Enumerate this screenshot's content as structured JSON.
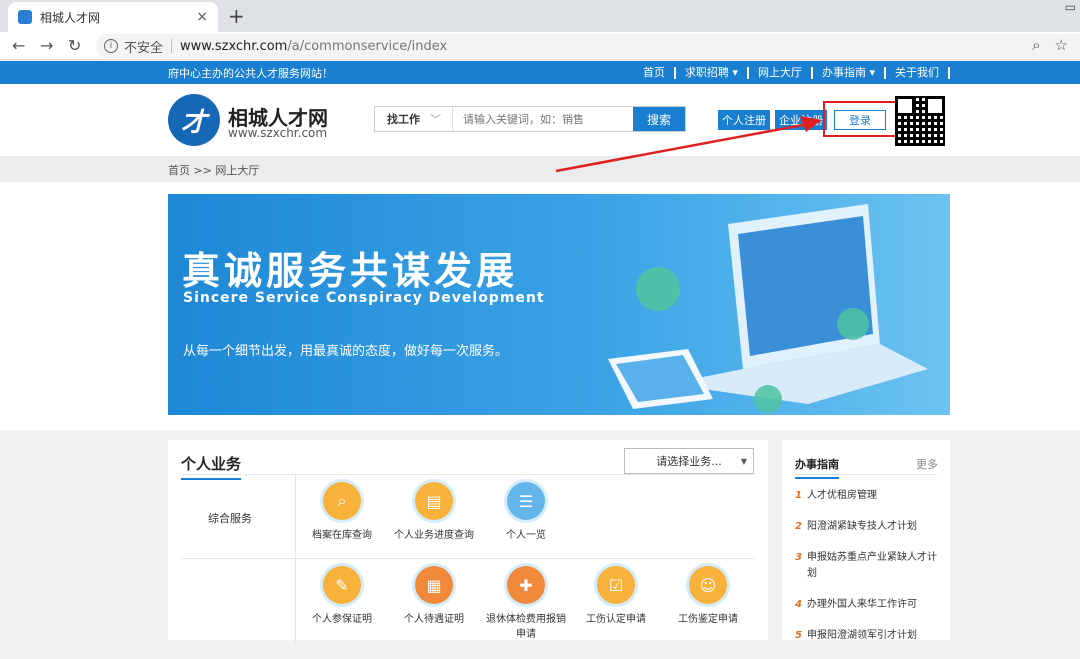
{
  "browser": {
    "tab_title": "相城人才网",
    "tab_close": "×",
    "new_tab": "+",
    "security_label": "不安全",
    "url_host": "www.szxchr.com",
    "url_path": "/a/commonservice/index"
  },
  "topbar": {
    "slogan": "府中心主办的公共人才服务网站！",
    "nav": [
      {
        "label": "首页"
      },
      {
        "label": "求职招聘 ▾"
      },
      {
        "label": "网上大厅"
      },
      {
        "label": "办事指南 ▾"
      },
      {
        "label": "关于我们"
      }
    ]
  },
  "header": {
    "logo_name": "相城人才网",
    "logo_url": "www.szxchr.com",
    "search_type": "找工作",
    "search_placeholder": "请输入关键词，如：销售",
    "search_button": "搜索",
    "personal_register": "个人注册",
    "company_register": "企业注册",
    "login": "登录"
  },
  "breadcrumb": "首页 >> 网上大厅",
  "banner": {
    "title": "真诚服务共谋发展",
    "subtitle": "Sincere Service Conspiracy Development",
    "description": "从每一个细节出发，用最真诚的态度，做好每一次服务。"
  },
  "personal": {
    "title": "个人业务",
    "select_label": "请选择业务...",
    "category": "综合服务",
    "services_row1": [
      {
        "label": "档案在库查询"
      },
      {
        "label": "个人业务进度查询"
      },
      {
        "label": "个人一览"
      }
    ],
    "services_row2": [
      {
        "label": "个人参保证明"
      },
      {
        "label": "个人待遇证明"
      },
      {
        "label": "退休体检费用报销申请"
      },
      {
        "label": "工伤认定申请"
      },
      {
        "label": "工伤鉴定申请"
      }
    ]
  },
  "guide": {
    "title": "办事指南",
    "more": "更多",
    "items": [
      {
        "num": "1",
        "label": "人才优租房管理"
      },
      {
        "num": "2",
        "label": "阳澄湖紧缺专技人才计划"
      },
      {
        "num": "3",
        "label": "申报姑苏重点产业紧缺人才计划"
      },
      {
        "num": "4",
        "label": "办理外国人来华工作许可"
      },
      {
        "num": "5",
        "label": "申报阳澄湖领军引才计划"
      }
    ]
  },
  "colors": {
    "brand": "#1a7fd1",
    "annotation": "#e02020"
  }
}
